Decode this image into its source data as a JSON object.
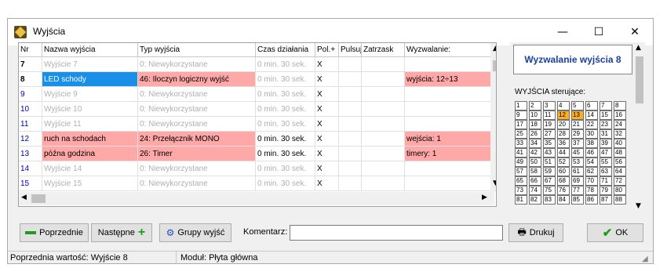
{
  "window": {
    "title": "Wyjścia",
    "minimize": "—",
    "maximize": "☐",
    "close": "✕"
  },
  "table": {
    "headers": [
      "Nr",
      "Nazwa wyjścia",
      "Typ wyjścia",
      "Czas działania",
      "Pol.+",
      "Pulsuj",
      "Zatrzask",
      "Wyzwalanie:"
    ],
    "rows": [
      {
        "nr": "7",
        "name": "Wyjście  7",
        "type": "0: Niewykorzystane",
        "time": "0  min. 30 sek.",
        "pol": "X",
        "pulse": "",
        "latch": "",
        "trig": ""
      },
      {
        "nr": "8",
        "name": "LED schody",
        "type": "46: Iloczyn logiczny wyjść",
        "time": "0  min. 30 sek.",
        "pol": "X",
        "pulse": "",
        "latch": "",
        "trig": "wyjścia: 12÷13"
      },
      {
        "nr": "9",
        "name": "Wyjście  9",
        "type": "0: Niewykorzystane",
        "time": "0  min. 30 sek.",
        "pol": "X",
        "pulse": "",
        "latch": "",
        "trig": ""
      },
      {
        "nr": "10",
        "name": "Wyjście  10",
        "type": "0: Niewykorzystane",
        "time": "0  min. 30 sek.",
        "pol": "X",
        "pulse": "",
        "latch": "",
        "trig": ""
      },
      {
        "nr": "11",
        "name": "Wyjście  11",
        "type": "0: Niewykorzystane",
        "time": "0  min. 30 sek.",
        "pol": "X",
        "pulse": "",
        "latch": "",
        "trig": ""
      },
      {
        "nr": "12",
        "name": "ruch na schodach",
        "type": "24: Przełącznik MONO",
        "time": "0  min. 30 sek.",
        "pol": "X",
        "pulse": "",
        "latch": "",
        "trig": "wejścia: 1"
      },
      {
        "nr": "13",
        "name": "późna godzina",
        "type": "26: Timer",
        "time": "0  min. 30 sek.",
        "pol": "X",
        "pulse": "",
        "latch": "",
        "trig": "timery: 1"
      },
      {
        "nr": "14",
        "name": "Wyjście  14",
        "type": "0: Niewykorzystane",
        "time": "0  min. 30 sek.",
        "pol": "X",
        "pulse": "",
        "latch": "",
        "trig": ""
      },
      {
        "nr": "15",
        "name": "Wyjście  15",
        "type": "0: Niewykorzystane",
        "time": "0  min. 30 sek.",
        "pol": "X",
        "pulse": "",
        "latch": "",
        "trig": ""
      }
    ]
  },
  "panel": {
    "title": "Wyzwalanie wyjścia 8",
    "label": "WYJŚCIA sterujące:",
    "numbers": [
      "1",
      "2",
      "3",
      "4",
      "5",
      "6",
      "7",
      "8",
      "9",
      "10",
      "11",
      "12",
      "13",
      "14",
      "15",
      "16",
      "17",
      "18",
      "19",
      "20",
      "21",
      "22",
      "23",
      "24",
      "25",
      "26",
      "27",
      "28",
      "29",
      "30",
      "31",
      "32",
      "33",
      "34",
      "35",
      "36",
      "37",
      "38",
      "39",
      "40",
      "41",
      "42",
      "43",
      "44",
      "45",
      "46",
      "47",
      "48",
      "49",
      "50",
      "51",
      "52",
      "53",
      "54",
      "55",
      "56",
      "57",
      "58",
      "59",
      "60",
      "61",
      "62",
      "63",
      "64",
      "65",
      "66",
      "67",
      "68",
      "69",
      "70",
      "71",
      "72",
      "73",
      "74",
      "75",
      "76",
      "77",
      "78",
      "79",
      "80",
      "81",
      "82",
      "83",
      "84",
      "85",
      "86",
      "87",
      "88"
    ],
    "active": [
      "12",
      "13"
    ],
    "active_color": "#ffb020"
  },
  "buttons": {
    "prev": "Poprzednie",
    "next": "Następne",
    "groups": "Grupy wyjść",
    "comment_label": "Komentarz:",
    "comment_value": "",
    "print": "Drukuj",
    "ok": "OK"
  },
  "status": {
    "left": "Poprzednia wartość: Wyjście  8",
    "right": "Moduł: Płyta główna"
  },
  "colors": {
    "pink": "#ffa8a8",
    "selected": "#1a8fe8",
    "number_blue": "#0000c0"
  }
}
